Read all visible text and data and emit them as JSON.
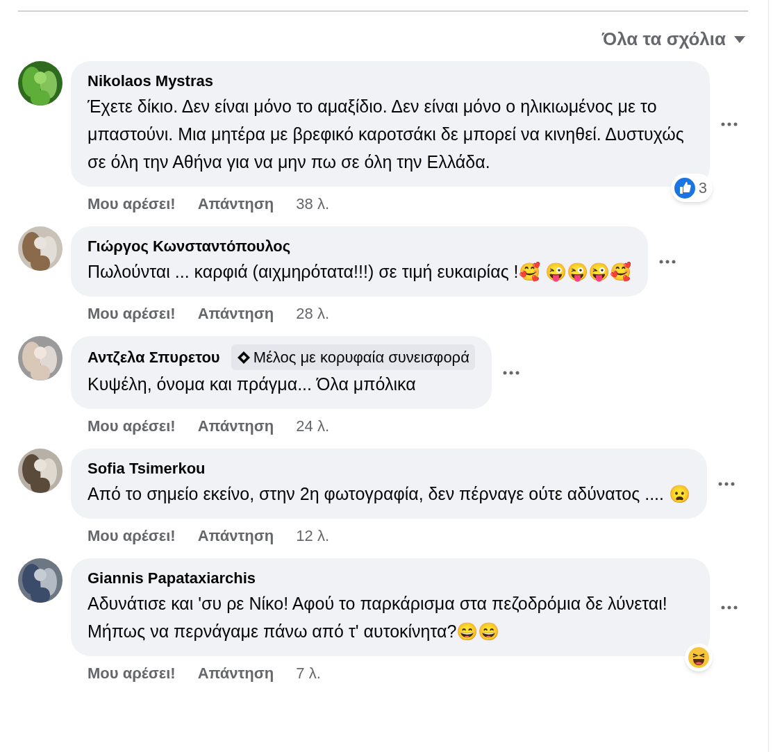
{
  "filter": {
    "label": "Όλα τα σχόλια"
  },
  "comments": [
    {
      "author": "Nikolaos Mystras",
      "text": "Έχετε δίκιο. Δεν είναι μόνο το αμαξίδιο. Δεν είναι μόνο ο ηλικιωμένος με το μπαστούνι. Μια μητέρα με βρεφικό καροτσάκι δε μπορεί να κινηθεί. Δυστυχώς σε όλη την Αθήνα για να μην πω σε όλη την Ελλάδα.",
      "reaction": {
        "kind": "like",
        "count": "3"
      },
      "like": "Μου αρέσει!",
      "reply": "Απάντηση",
      "time": "38 λ."
    },
    {
      "author": "Γιώργος Κωνσταντόπουλος",
      "text": "Πωλούνται ... καρφιά (αιχμηρότατα!!!) σε τιμή ευκαιρίας !🥰 😜😜😜🥰",
      "like": "Μου αρέσει!",
      "reply": "Απάντηση",
      "time": "28 λ."
    },
    {
      "author": "Αντζελα Σπυρετου",
      "badge": "Μέλος με κορυφαία συνεισφορά",
      "text": "Κυψέλη, όνομα και πράγμα... Όλα μπόλικα",
      "like": "Μου αρέσει!",
      "reply": "Απάντηση",
      "time": "24 λ."
    },
    {
      "author": "Sofia Tsimerkou",
      "text": "Από το σημείο εκείνο, στην 2η φωτογραφία, δεν πέρναγε ούτε αδύνατος .... 😦",
      "like": "Μου αρέσει!",
      "reply": "Απάντηση",
      "time": "12 λ."
    },
    {
      "author": "Giannis Papataxiarchis",
      "text": "Αδυνάτισε και 'συ ρε Νίκο! Αφού το παρκάρισμα στα πεζοδρόμια δε λύνεται! Μήπως να περνάγαμε πάνω από τ' αυτοκίνητα?😄😄",
      "reaction": {
        "kind": "haha"
      },
      "like": "Μου αρέσει!",
      "reply": "Απάντηση",
      "time": "7 λ."
    }
  ]
}
